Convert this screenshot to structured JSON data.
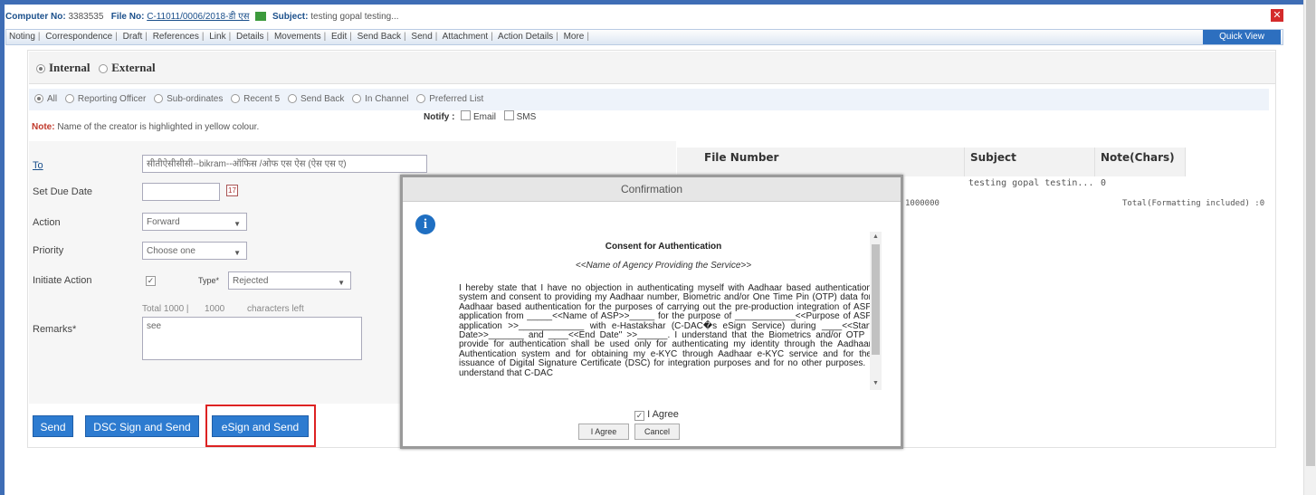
{
  "header": {
    "computer_no_label": "Computer No:",
    "computer_no": "3383535",
    "file_no_label": "File No:",
    "file_no": "C-11011/0006/2018-डी एस",
    "subject_label": "Subject:",
    "subject": "testing gopal testing..."
  },
  "menu": {
    "items": [
      "Noting",
      "Correspondence",
      "Draft",
      "References",
      "Link",
      "Details",
      "Movements",
      "Edit",
      "Send Back",
      "Send",
      "Attachment",
      "Action Details",
      "More"
    ],
    "quick_view": "Quick View"
  },
  "scope": {
    "internal": "Internal",
    "external": "External"
  },
  "filters": [
    "All",
    "Reporting Officer",
    "Sub-ordinates",
    "Recent 5",
    "Send Back",
    "In Channel",
    "Preferred List"
  ],
  "note": {
    "label": "Note:",
    "text": " Name of the creator is highlighted in yellow colour."
  },
  "form": {
    "to_label": "To",
    "to_value": "सीतीऐसीसीसी--bikram--ऑफिस /ओफ एस ऐस (ऐस एस ए)",
    "notify_label": "Notify :",
    "email_label": "Email",
    "sms_label": "SMS",
    "due_date_label": "Set Due Date",
    "calendar_glyph": "17",
    "action_label": "Action",
    "action_value": "Forward",
    "priority_label": "Priority",
    "priority_value": "Choose one",
    "initiate_label": "Initiate Action",
    "type_label": "Type*",
    "type_value": "Rejected",
    "total_text": "Total 1000 |",
    "chars_left_value": "1000",
    "chars_left_text": "characters left",
    "remarks_label": "Remarks*",
    "remarks_value": "see"
  },
  "table": {
    "headers": [
      "File Number",
      "Subject",
      "Note(Chars)"
    ],
    "row": {
      "subject": "testing gopal testin...",
      "note": "0"
    },
    "file_number_partial": "1000000",
    "total_text": "Total(Formatting included) :0"
  },
  "buttons": {
    "send": "Send",
    "dsc_sign": "DSC Sign and Send",
    "esign": "eSign and Send"
  },
  "modal": {
    "title": "Confirmation",
    "consent_title": "Consent for Authentication",
    "agency": "<<Name of Agency Providing the Service>>",
    "body": "I hereby state that I have no objection in authenticating myself with Aadhaar based authentication system and consent to providing my Aadhaar number, Biometric and/or One Time Pin (OTP) data for Aadhaar based authentication for the purposes of carrying out the pre-production integration of ASP application from _____<<Name of ASP>>_____ for the purpose of ____________<<Purpose of ASP application >>_____________ with e-Hastakshar (C-DAC�s eSign Service) during ____<<Start Date>>_______ and ____<<End Date\" >>______. I understand that the Biometrics and/or OTP I provide for authentication shall be used only for authenticating my identity through the Aadhaar Authentication system and for obtaining my e-KYC through Aadhaar e-KYC service and for the issuance of Digital Signature Certificate (DSC) for integration purposes and for no other purposes. I understand that C-DAC",
    "agree_label": "I Agree",
    "agree_button": "I Agree",
    "cancel_button": "Cancel"
  }
}
